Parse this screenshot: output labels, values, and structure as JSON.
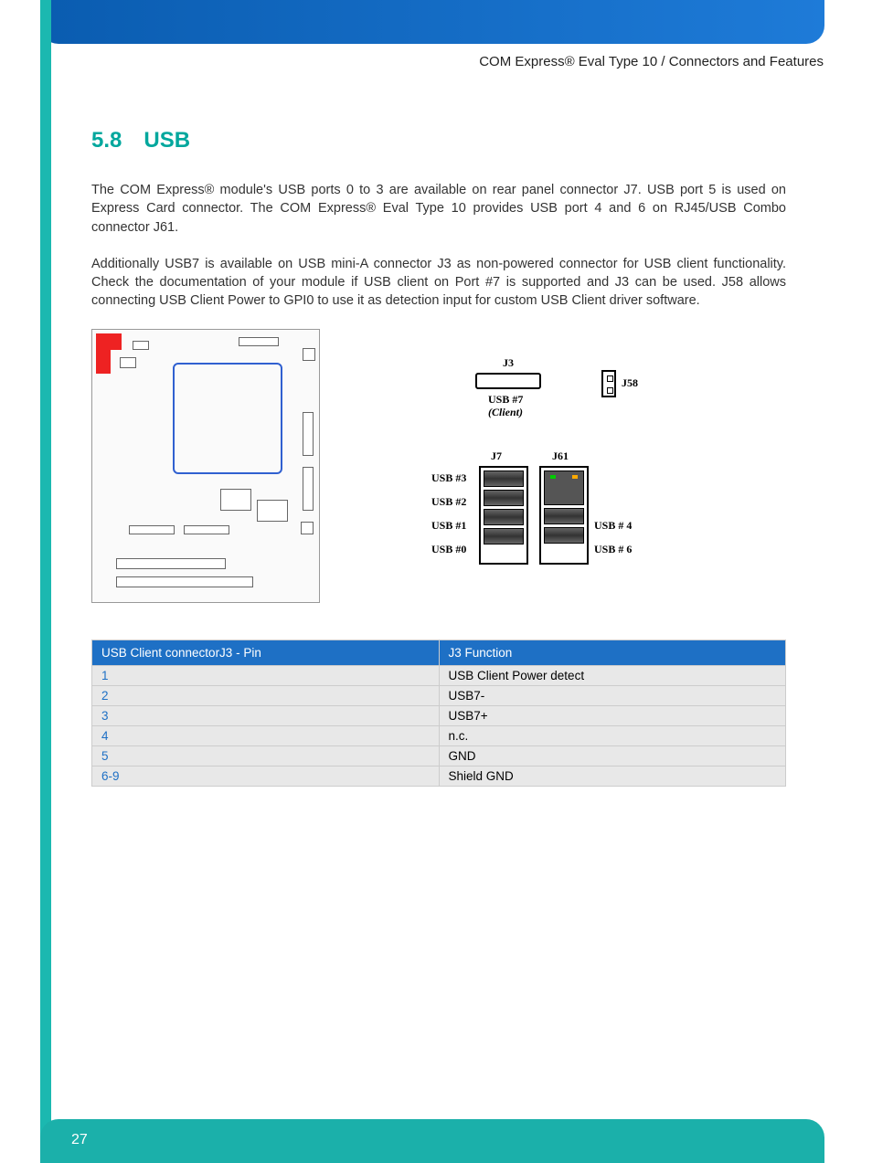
{
  "header": {
    "breadcrumb": "COM Express® Eval Type 10 / Connectors and Features"
  },
  "section": {
    "number": "5.8",
    "title": "USB"
  },
  "paragraphs": [
    "The COM Express® module's USB ports 0 to 3 are available on rear panel connector J7. USB port 5 is used on Express Card connector. The COM Express® Eval Type 10 provides USB port 4 and 6 on RJ45/USB Combo connector J61.",
    "Additionally USB7 is available on USB mini-A connector J3 as non-powered connector for USB client functionality. Check the documentation of your module if USB client on Port #7 is supported and J3 can be used. J58 allows connecting USB Client Power to GPI0 to use it as detection input for custom USB Client driver software."
  ],
  "connector_diagram": {
    "j3_label": "J3",
    "j3_sub1": "USB #7",
    "j3_sub2": "(Client)",
    "j58_label": "J58",
    "j7_label": "J7",
    "j61_label": "J61",
    "j7_ports": [
      "USB #3",
      "USB #2",
      "USB #1",
      "USB #0"
    ],
    "j61_ports": [
      "USB # 4",
      "USB # 6"
    ]
  },
  "table": {
    "headers": [
      "USB Client connectorJ3 - Pin",
      "J3 Function"
    ],
    "rows": [
      [
        "1",
        "USB Client Power detect"
      ],
      [
        "2",
        "USB7-"
      ],
      [
        "3",
        "USB7+"
      ],
      [
        "4",
        "n.c."
      ],
      [
        "5",
        "GND"
      ],
      [
        "6-9",
        "Shield GND"
      ]
    ]
  },
  "footer": {
    "page_number": "27"
  }
}
